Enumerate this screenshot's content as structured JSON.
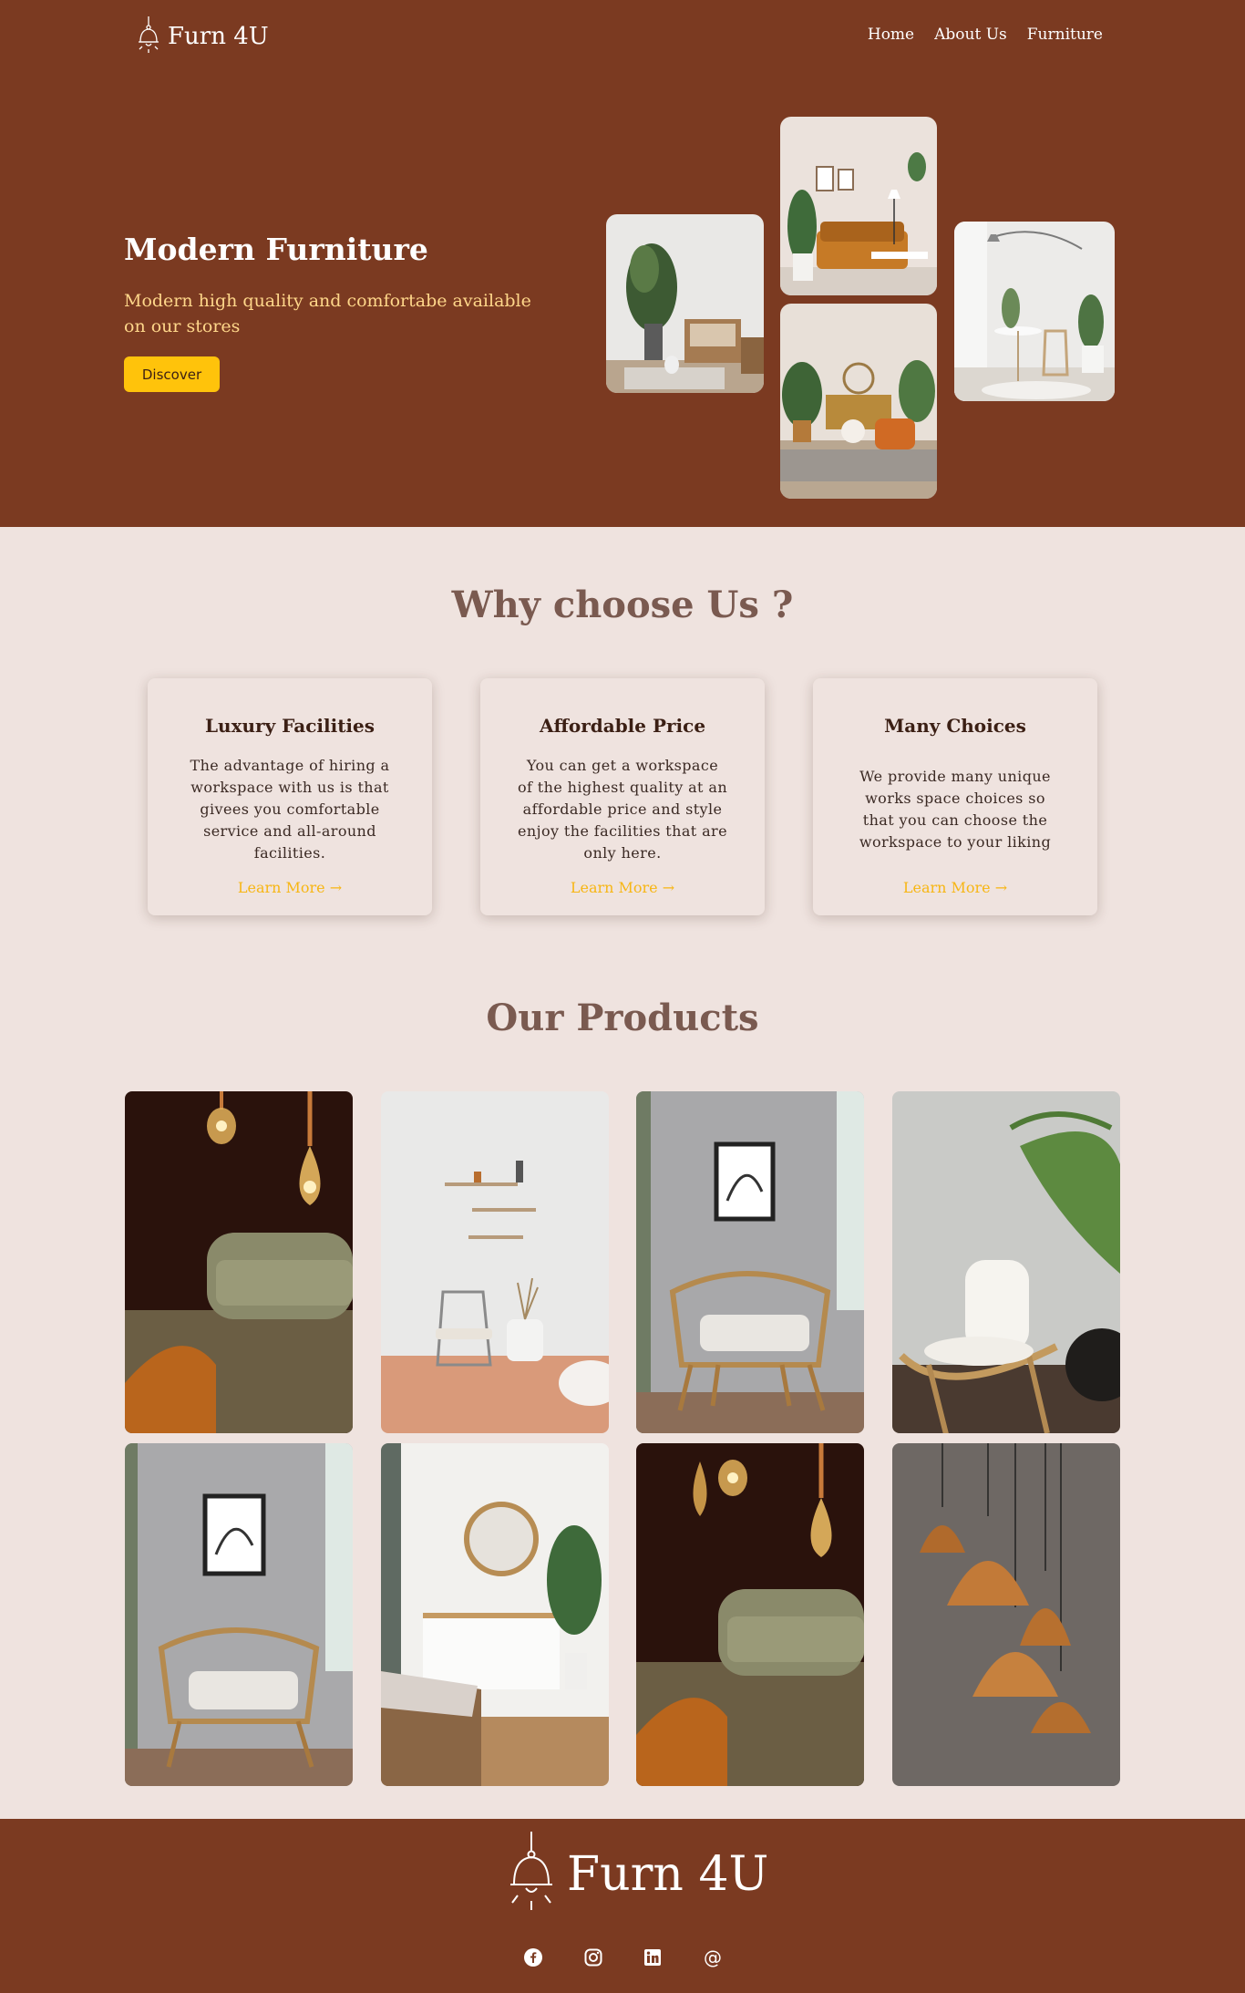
{
  "brand": {
    "name": "Furn 4U"
  },
  "nav": {
    "items": [
      "Home",
      "About Us",
      "Furniture"
    ]
  },
  "hero": {
    "title": "Modern Furniture",
    "subtitle": "Modern high quality and comfortabe available on our stores",
    "cta": "Discover"
  },
  "why": {
    "title": "Why choose Us ?",
    "cards": [
      {
        "title": "Luxury Facilities",
        "text": "The advantage of hiring a workspace with us is that givees you comfortable service and all-around facilities.",
        "link": "Learn More"
      },
      {
        "title": "Affordable Price",
        "text": "You can get a workspace of the highest quality at an affordable price and style enjoy the facilities that are only here.",
        "link": "Learn More"
      },
      {
        "title": "Many Choices",
        "text": "We provide many unique works space choices so that you can choose the workspace to your liking",
        "link": "Learn More"
      }
    ]
  },
  "products": {
    "title": "Our Products"
  },
  "footer": {
    "brand": "Furn 4U",
    "socials": [
      "facebook-icon",
      "instagram-icon",
      "linkedin-icon",
      "email-at-icon"
    ],
    "at_symbol": "@"
  },
  "colors": {
    "primary": "#7b3a21",
    "accent": "#ffc30b",
    "background": "#efe3df",
    "link": "#f7b614"
  }
}
